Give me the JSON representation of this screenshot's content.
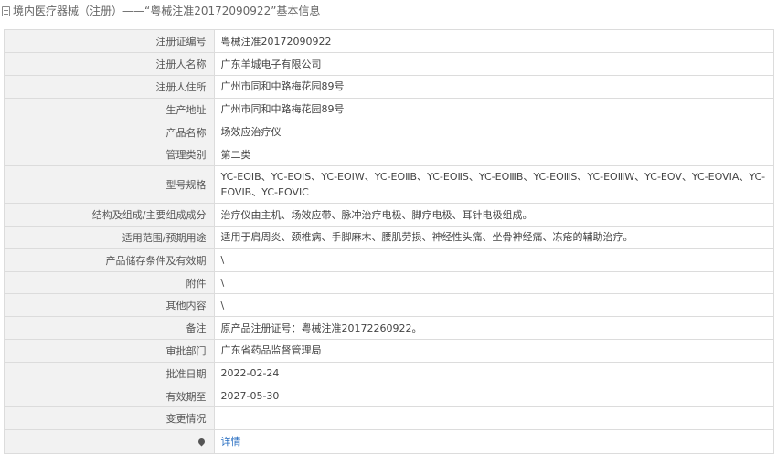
{
  "header": {
    "title": "境内医疗器械（注册）——“粤械注准20172090922”基本信息"
  },
  "rows": [
    {
      "label": "注册证编号",
      "value": "粤械注准20172090922"
    },
    {
      "label": "注册人名称",
      "value": "广东羊城电子有限公司"
    },
    {
      "label": "注册人住所",
      "value": "广州市同和中路梅花园89号"
    },
    {
      "label": "生产地址",
      "value": "广州市同和中路梅花园89号"
    },
    {
      "label": "产品名称",
      "value": "场效应治疗仪"
    },
    {
      "label": "管理类别",
      "value": "第二类"
    },
    {
      "label": "型号规格",
      "value": "YC-EOⅠB、YC-EOⅠS、YC-EOⅠW、YC-EOⅡB、YC-EOⅡS、YC-EOⅢB、YC-EOⅢS、YC-EOⅢW、YC-EOV、YC-EOVIA、YC-EOVIB、YC-EOVIC"
    },
    {
      "label": "结构及组成/主要组成成分",
      "value": "治疗仪由主机、场效应带、脉冲治疗电极、脚疗电极、耳针电极组成。"
    },
    {
      "label": "适用范围/预期用途",
      "value": "适用于肩周炎、颈椎病、手脚麻木、腰肌劳损、神经性头痛、坐骨神经痛、冻疮的辅助治疗。"
    },
    {
      "label": "产品储存条件及有效期",
      "value": "\\"
    },
    {
      "label": "附件",
      "value": "\\"
    },
    {
      "label": "其他内容",
      "value": "\\"
    },
    {
      "label": "备注",
      "value": "原产品注册证号：粤械注准20172260922。"
    },
    {
      "label": "审批部门",
      "value": "广东省药品监督管理局"
    },
    {
      "label": "批准日期",
      "value": "2022-02-24"
    },
    {
      "label": "有效期至",
      "value": "2027-05-30"
    },
    {
      "label": "变更情况",
      "value": ""
    }
  ],
  "detail_row": {
    "icon": "map-pin-icon",
    "label": "",
    "link_text": "详情"
  }
}
